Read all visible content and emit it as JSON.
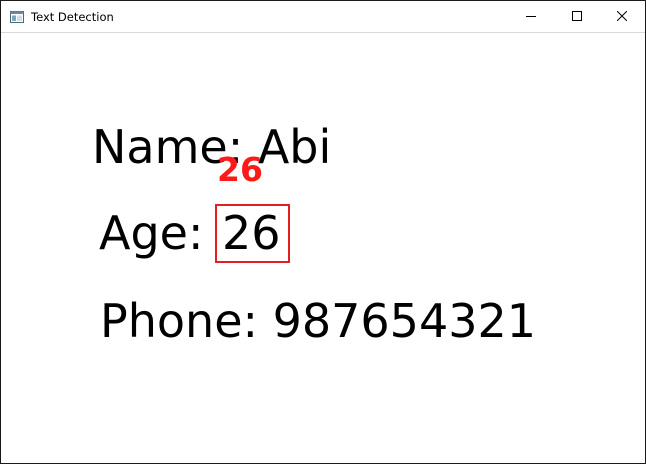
{
  "window": {
    "title": "Text Detection",
    "app_icon": "window-app-icon",
    "controls": {
      "minimize_icon": "minimize-icon",
      "maximize_icon": "maximize-icon",
      "close_icon": "close-icon"
    }
  },
  "image": {
    "lines": {
      "name": "Name: Abi",
      "age_label": "Age:",
      "age_value": "26",
      "phone": "Phone: 987654321"
    },
    "detection": {
      "label": "26",
      "box_color": "#e02020",
      "label_color": "#ff1a1a"
    }
  }
}
